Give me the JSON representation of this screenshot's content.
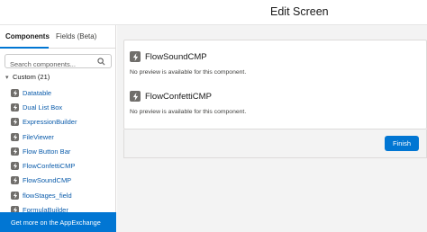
{
  "header": {
    "title": "Edit Screen"
  },
  "tabs": [
    {
      "label": "Components",
      "active": true
    },
    {
      "label": "Fields (Beta)",
      "active": false
    }
  ],
  "search": {
    "placeholder": "Search components..."
  },
  "group": {
    "label": "Custom (21)"
  },
  "items": [
    {
      "label": "Datatable"
    },
    {
      "label": "Dual List Box"
    },
    {
      "label": "ExpressionBuilder"
    },
    {
      "label": "FileViewer"
    },
    {
      "label": "Flow Button Bar"
    },
    {
      "label": "FlowConfettiCMP"
    },
    {
      "label": "FlowSoundCMP"
    },
    {
      "label": "flowStages_field"
    },
    {
      "label": "FormulaBuilder"
    }
  ],
  "appexchange_label": "Get more on the AppExchange",
  "canvas": {
    "components": [
      {
        "title": "FlowSoundCMP",
        "message": "No preview is available for this component."
      },
      {
        "title": "FlowConfettiCMP",
        "message": "No preview is available for this component."
      }
    ],
    "finish_label": "Finish"
  },
  "colors": {
    "brand": "#0176d3",
    "link": "#0b5cab",
    "icon_bg": "#706e6b"
  },
  "icons": {
    "component": "lightning-bolt-icon",
    "search": "search-icon",
    "group": "chevron-down-icon"
  }
}
